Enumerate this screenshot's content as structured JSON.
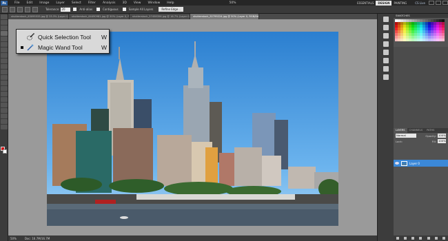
{
  "menubar": {
    "app_icon": "Ps",
    "items": [
      "File",
      "Edit",
      "Image",
      "Layer",
      "Select",
      "Filter",
      "Analysis",
      "3D",
      "View",
      "Window",
      "Help"
    ],
    "zoom": "50%",
    "workspaces": [
      "ESSENTIALS",
      "DESIGN",
      "PAINTING"
    ],
    "active_workspace": "DESIGN",
    "cs_live": "CS Live"
  },
  "options": {
    "tolerance_label": "Tolerance:",
    "tolerance_value": "20",
    "antialias_label": "Anti-alias",
    "contiguous_label": "Contiguous",
    "sample_all_label": "Sample All Layers",
    "refine_edge": "Refine Edge..."
  },
  "tabs": [
    "shutterstock_63095533.jpg @ 33.3% (Layer 0, RGB/8#)",
    "shutterstock_64490981.jpg @ 50% (Layer 0, RGB/8#)",
    "shutterstock_57458356.jpg @ 16.7% (Layer 0, RGB/8#)",
    "shutterstock_92799224.jpg @ 50% (Layer 0, RGB/8#)"
  ],
  "flyout": {
    "items": [
      {
        "label": "Quick Selection Tool",
        "shortcut": "W",
        "icon": "quick-selection-icon"
      },
      {
        "label": "Magic Wand Tool",
        "shortcut": "W",
        "icon": "magic-wand-icon"
      }
    ]
  },
  "status": {
    "zoom": "50%",
    "doc": "Doc: 16.7M/16.7M"
  },
  "panels": {
    "swatches_title": "SWATCHES",
    "layers_tabs": [
      "LAYERS",
      "CHANNELS",
      "PATHS"
    ],
    "blend_mode": "Normal",
    "opacity_label": "Opacity:",
    "opacity_value": "100%",
    "lock_label": "Lock:",
    "fill_label": "Fill:",
    "fill_value": "100%",
    "layer_name": "Layer 0"
  },
  "colors": {
    "foreground": "#d31616",
    "background": "#ffffff",
    "selected_layer": "#3b88d8"
  }
}
